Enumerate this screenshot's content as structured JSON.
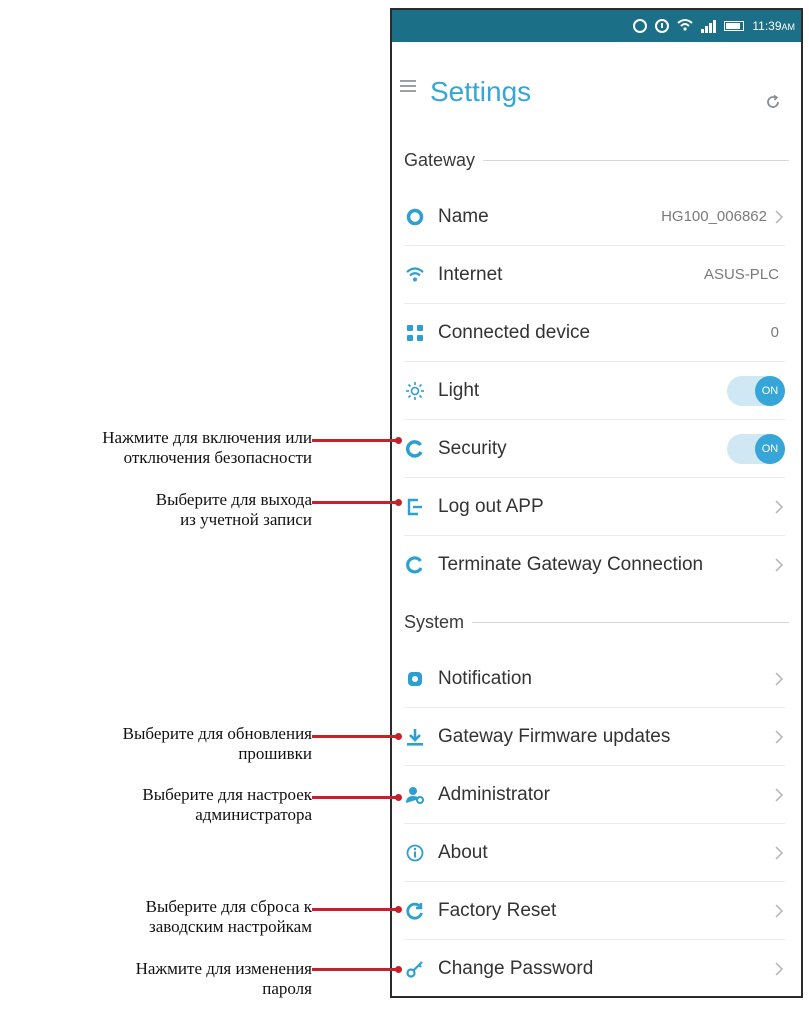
{
  "status_bar": {
    "time": "11:39",
    "ampm": "AM"
  },
  "header": {
    "title": "Settings"
  },
  "sections": {
    "gateway": {
      "title": "Gateway"
    },
    "system": {
      "title": "System"
    }
  },
  "gateway_rows": {
    "name": {
      "label": "Name",
      "value": "HG100_006862"
    },
    "internet": {
      "label": "Internet",
      "value": "ASUS-PLC"
    },
    "connected": {
      "label": "Connected device",
      "value": "0"
    },
    "light": {
      "label": "Light",
      "toggle": "ON"
    },
    "security": {
      "label": "Security",
      "toggle": "ON"
    },
    "logout": {
      "label": "Log out APP"
    },
    "terminate": {
      "label": "Terminate Gateway Connection"
    }
  },
  "system_rows": {
    "notification": {
      "label": "Notification"
    },
    "firmware": {
      "label": "Gateway Firmware updates"
    },
    "administrator": {
      "label": "Administrator"
    },
    "about": {
      "label": "About"
    },
    "factory_reset": {
      "label": "Factory Reset"
    },
    "change_password": {
      "label": "Change Password"
    }
  },
  "annotations": {
    "security": [
      "Нажмите для включения или",
      "отключения безопасности"
    ],
    "logout": [
      "Выберите для выхода",
      "из учетной записи"
    ],
    "firmware": [
      "Выберите для обновления",
      "прошивки"
    ],
    "administrator": [
      "Выберите для настроек",
      "администратора"
    ],
    "factory_reset": [
      "Выберите для сброса к",
      "заводским настройкам"
    ],
    "change_password": [
      "Нажмите для изменения",
      "пароля"
    ]
  },
  "colors": {
    "accent": "#35a7d6",
    "status_bar": "#1b6f86",
    "annotation_line": "#c8202a"
  }
}
